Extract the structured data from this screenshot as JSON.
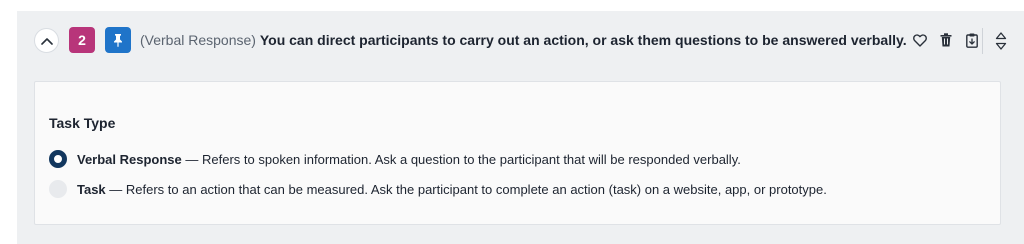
{
  "question": {
    "number": "2",
    "type_prefix": "(Verbal Response)",
    "text": "You can direct participants to carry out an action, or ask them questions to be answered verbally.",
    "number_color": "#b8357a",
    "pin_color": "#1f74c9"
  },
  "header": {
    "collapse_icon": "chevron-up-icon",
    "pin_icon": "pin-icon",
    "actions": [
      "heart-icon",
      "trash-icon",
      "clipboard-icon",
      "reorder-icon"
    ]
  },
  "task_type": {
    "label": "Task Type",
    "options": [
      {
        "name": "Verbal Response",
        "description": " — Refers to spoken information. Ask a question to the participant that will be responded verbally.",
        "selected": true
      },
      {
        "name": "Task",
        "description": " — Refers to an action that can be measured. Ask the participant to complete an action (task) on a website, app, or prototype.",
        "selected": false
      }
    ]
  },
  "colors": {
    "card_bg": "#eef0f2",
    "radio_selected": "#12375e"
  }
}
